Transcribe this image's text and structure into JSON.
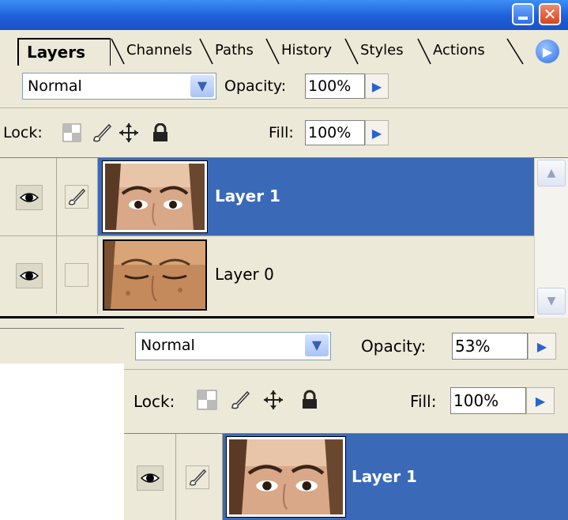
{
  "window": {
    "minimize_icon": "minimize-icon",
    "close_icon": "close-icon"
  },
  "tabs": [
    {
      "label": "Layers",
      "active": true
    },
    {
      "label": "Channels"
    },
    {
      "label": "Paths"
    },
    {
      "label": "History"
    },
    {
      "label": "Styles"
    },
    {
      "label": "Actions"
    }
  ],
  "panel_menu_icon": "triangle-right-icon",
  "blend": {
    "mode": "Normal",
    "opacity_label": "Opacity:",
    "opacity_value": "100%"
  },
  "lock": {
    "label": "Lock:",
    "icons": [
      "lock-transparent-icon",
      "lock-paint-icon",
      "lock-move-icon",
      "lock-all-icon"
    ],
    "fill_label": "Fill:",
    "fill_value": "100%"
  },
  "layers": [
    {
      "name": "Layer 1",
      "selected": true,
      "visible": true,
      "linked_brush": true
    },
    {
      "name": "Layer 0",
      "selected": false,
      "visible": true,
      "linked_brush": false
    }
  ],
  "zoomed": {
    "blend_mode": "Normal",
    "opacity_label": "Opacity:",
    "opacity_value": "53%",
    "lock_label": "Lock:",
    "fill_label": "Fill:",
    "fill_value": "100%",
    "layer_name": "Layer 1"
  },
  "colors": {
    "selection": "#3a69b8",
    "panel_bg": "#ece9d8",
    "titlebar": "#1e5fd8"
  }
}
